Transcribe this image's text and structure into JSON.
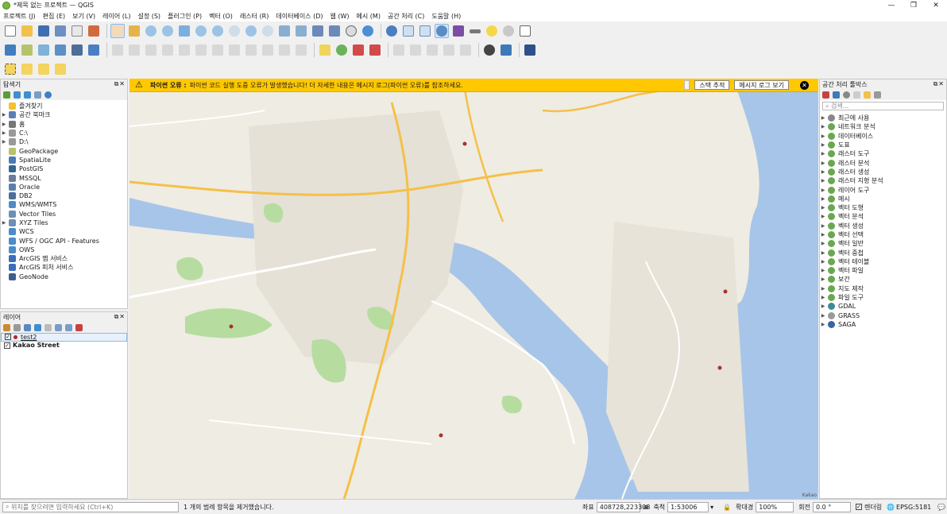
{
  "window": {
    "title": "*제목 없는 프로젝트 — QGIS"
  },
  "menu": [
    "프로젝트 (J)",
    "편집 (E)",
    "보기 (V)",
    "레이어 (L)",
    "설정 (S)",
    "플러그인 (P)",
    "벡터 (O)",
    "래스터 (R)",
    "데이터베이스 (D)",
    "웹 (W)",
    "메시 (M)",
    "공간 처리 (C)",
    "도움말 (H)"
  ],
  "browser": {
    "title": "탐색기",
    "items": [
      {
        "label": "즐겨찾기",
        "icon": "star-icon",
        "color": "#f2c12e",
        "expand": false
      },
      {
        "label": "공간 북마크",
        "icon": "bookmark-icon",
        "color": "#5b7fb5",
        "expand": true
      },
      {
        "label": "홈",
        "icon": "folder-icon",
        "color": "#777777",
        "expand": true
      },
      {
        "label": "C:\\",
        "icon": "drive-icon",
        "color": "#999999",
        "expand": true
      },
      {
        "label": "D:\\",
        "icon": "drive-icon",
        "color": "#999999",
        "expand": true
      },
      {
        "label": "GeoPackage",
        "icon": "geopackage-icon",
        "color": "#b5c36b",
        "expand": false
      },
      {
        "label": "SpatiaLite",
        "icon": "spatialite-icon",
        "color": "#4b7bb7",
        "expand": false
      },
      {
        "label": "PostGIS",
        "icon": "postgis-icon",
        "color": "#336791",
        "expand": false
      },
      {
        "label": "MSSQL",
        "icon": "mssql-icon",
        "color": "#6c7c99",
        "expand": false
      },
      {
        "label": "Oracle",
        "icon": "oracle-icon",
        "color": "#5a7fa8",
        "expand": false
      },
      {
        "label": "DB2",
        "icon": "db2-icon",
        "color": "#4a6f9a",
        "expand": false
      },
      {
        "label": "WMS/WMTS",
        "icon": "wms-icon",
        "color": "#4c8cc8",
        "expand": false
      },
      {
        "label": "Vector Tiles",
        "icon": "vector-tiles-icon",
        "color": "#6f8fb3",
        "expand": false
      },
      {
        "label": "XYZ Tiles",
        "icon": "xyz-tiles-icon",
        "color": "#6f8fb3",
        "expand": true
      },
      {
        "label": "WCS",
        "icon": "wcs-icon",
        "color": "#4c8cc8",
        "expand": false
      },
      {
        "label": "WFS / OGC API - Features",
        "icon": "wfs-icon",
        "color": "#4c8cc8",
        "expand": false
      },
      {
        "label": "OWS",
        "icon": "ows-icon",
        "color": "#4c8cc8",
        "expand": false
      },
      {
        "label": "ArcGIS 맵 서비스",
        "icon": "arcgis-map-icon",
        "color": "#3b6fb6",
        "expand": false
      },
      {
        "label": "ArcGIS 피처 서비스",
        "icon": "arcgis-feature-icon",
        "color": "#3b6fb6",
        "expand": false
      },
      {
        "label": "GeoNode",
        "icon": "geonode-icon",
        "color": "#3f5f8a",
        "expand": false
      }
    ]
  },
  "layers": {
    "title": "레이어",
    "items": [
      {
        "label": "test2",
        "checked": "✓"
      },
      {
        "label": "Kakao Street",
        "checked": "✓"
      }
    ]
  },
  "toolbox": {
    "title": "공간 처리 툴박스",
    "search_placeholder": "검색...",
    "items": [
      {
        "label": "최근에 사용",
        "icon": "clock-icon",
        "color": "#888888"
      },
      {
        "label": "네트워크 분석",
        "icon": "qgis-icon",
        "color": "#6aa84f"
      },
      {
        "label": "데이터베이스",
        "icon": "qgis-icon",
        "color": "#6aa84f"
      },
      {
        "label": "도표",
        "icon": "qgis-icon",
        "color": "#6aa84f"
      },
      {
        "label": "래스터 도구",
        "icon": "qgis-icon",
        "color": "#6aa84f"
      },
      {
        "label": "래스터 분석",
        "icon": "qgis-icon",
        "color": "#6aa84f"
      },
      {
        "label": "래스터 생성",
        "icon": "qgis-icon",
        "color": "#6aa84f"
      },
      {
        "label": "래스터 지형 분석",
        "icon": "qgis-icon",
        "color": "#6aa84f"
      },
      {
        "label": "레이어 도구",
        "icon": "qgis-icon",
        "color": "#6aa84f"
      },
      {
        "label": "메시",
        "icon": "qgis-icon",
        "color": "#6aa84f"
      },
      {
        "label": "벡터 도형",
        "icon": "qgis-icon",
        "color": "#6aa84f"
      },
      {
        "label": "벡터 분석",
        "icon": "qgis-icon",
        "color": "#6aa84f"
      },
      {
        "label": "벡터 생성",
        "icon": "qgis-icon",
        "color": "#6aa84f"
      },
      {
        "label": "벡터 선택",
        "icon": "qgis-icon",
        "color": "#6aa84f"
      },
      {
        "label": "벡터 일반",
        "icon": "qgis-icon",
        "color": "#6aa84f"
      },
      {
        "label": "벡터 중첩",
        "icon": "qgis-icon",
        "color": "#6aa84f"
      },
      {
        "label": "벡터 테이블",
        "icon": "qgis-icon",
        "color": "#6aa84f"
      },
      {
        "label": "벡터 파일",
        "icon": "qgis-icon",
        "color": "#6aa84f"
      },
      {
        "label": "보간",
        "icon": "qgis-icon",
        "color": "#6aa84f"
      },
      {
        "label": "지도 제작",
        "icon": "qgis-icon",
        "color": "#6aa84f"
      },
      {
        "label": "파일 도구",
        "icon": "qgis-icon",
        "color": "#6aa84f"
      },
      {
        "label": "GDAL",
        "icon": "gdal-icon",
        "color": "#3e8a9a"
      },
      {
        "label": "GRASS",
        "icon": "grass-icon",
        "color": "#9a9a9a"
      },
      {
        "label": "SAGA",
        "icon": "saga-icon",
        "color": "#3a64a8"
      }
    ]
  },
  "message": {
    "title": "파이썬 오류 :",
    "text": "파이썬 코드 실행 도중 오류가 발생했습니다! 더 자세한 내용은 메시지 로그(파이썬 오류)를 참조하세요.",
    "stack_button": "스택 추적",
    "log_button": "메시지 로그 보기"
  },
  "map": {
    "attribution": "Kakao"
  },
  "status": {
    "locate_placeholder": "위치를 찾으려면 입력하세요 (Ctrl+K)",
    "message": "1 개의 범례 항목을 제거했습니다.",
    "coord_label": "좌표",
    "coord_value": "408728,223308",
    "scale_label": "축척",
    "scale_value": "1:53006",
    "magnifier_label": "확대경",
    "magnifier_value": "100%",
    "rotation_label": "회전",
    "rotation_value": "0.0 °",
    "render_label": "렌더링",
    "crs": "EPSG:5181"
  }
}
